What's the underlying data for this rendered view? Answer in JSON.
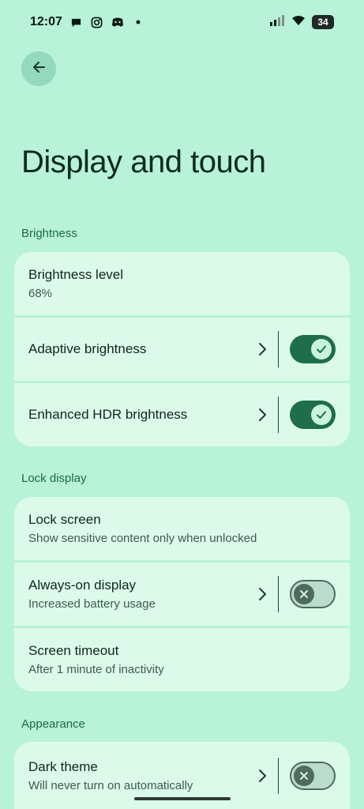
{
  "status_bar": {
    "time": "12:07",
    "battery": "34",
    "notification_icons": [
      "chat-bubble-icon",
      "instagram-icon",
      "discord-icon",
      "more-dot-icon"
    ]
  },
  "header": {
    "title": "Display and touch"
  },
  "sections": {
    "brightness": {
      "header": "Brightness",
      "items": [
        {
          "title": "Brightness level",
          "subtitle": "68%"
        },
        {
          "title": "Adaptive brightness",
          "toggle": "on"
        },
        {
          "title": "Enhanced HDR brightness",
          "toggle": "on"
        }
      ]
    },
    "lock_display": {
      "header": "Lock display",
      "items": [
        {
          "title": "Lock screen",
          "subtitle": "Show sensitive content only when unlocked"
        },
        {
          "title": "Always-on display",
          "subtitle": "Increased battery usage",
          "toggle": "off"
        },
        {
          "title": "Screen timeout",
          "subtitle": "After 1 minute of inactivity"
        }
      ]
    },
    "appearance": {
      "header": "Appearance",
      "items": [
        {
          "title": "Dark theme",
          "subtitle": "Will never turn on automatically",
          "toggle": "off"
        }
      ]
    }
  },
  "colors": {
    "background": "#b8f2d8",
    "card": "#dcfaea",
    "accent": "#1e6e4b",
    "section_header": "#1b6a47"
  }
}
